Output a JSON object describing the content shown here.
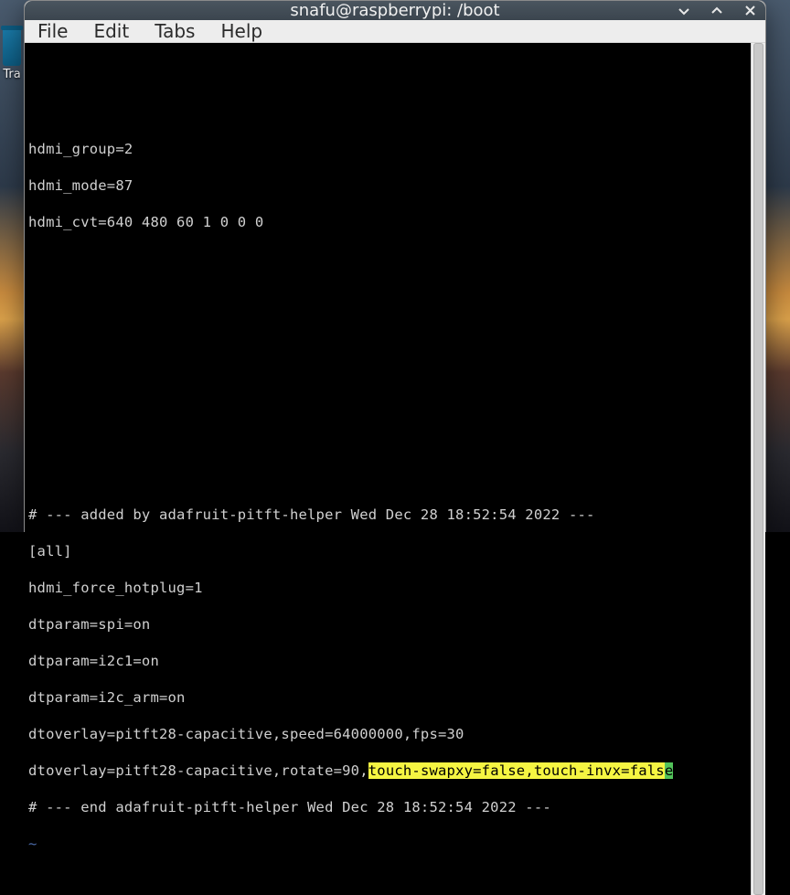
{
  "desktop": {
    "trash_label": "Tra"
  },
  "window": {
    "title": "snafu@raspberrypi: /boot"
  },
  "menubar": {
    "file": "File",
    "edit": "Edit",
    "tabs": "Tabs",
    "help": "Help"
  },
  "terminal": {
    "lines": {
      "l0": "",
      "l1": "",
      "l2": "hdmi_group=2",
      "l3": "hdmi_mode=87",
      "l4": "hdmi_cvt=640 480 60 1 0 0 0",
      "l5": "",
      "l6": "",
      "l7": "",
      "l8": "",
      "l9": "",
      "l10": "",
      "l11": "",
      "l12": "# --- added by adafruit-pitft-helper Wed Dec 28 18:52:54 2022 ---",
      "l13": "[all]",
      "l14": "hdmi_force_hotplug=1",
      "l15": "dtparam=spi=on",
      "l16": "dtparam=i2c1=on",
      "l17": "dtparam=i2c_arm=on",
      "l18": "dtoverlay=pitft28-capacitive,speed=64000000,fps=30",
      "l19a": "dtoverlay=pitft28-capacitive,rotate=90,",
      "l19b": "touch-swapxy=false,touch-invx=fals",
      "l19c": "e",
      "l20": "# --- end adafruit-pitft-helper Wed Dec 28 18:52:54 2022 ---",
      "l21": "~"
    }
  }
}
